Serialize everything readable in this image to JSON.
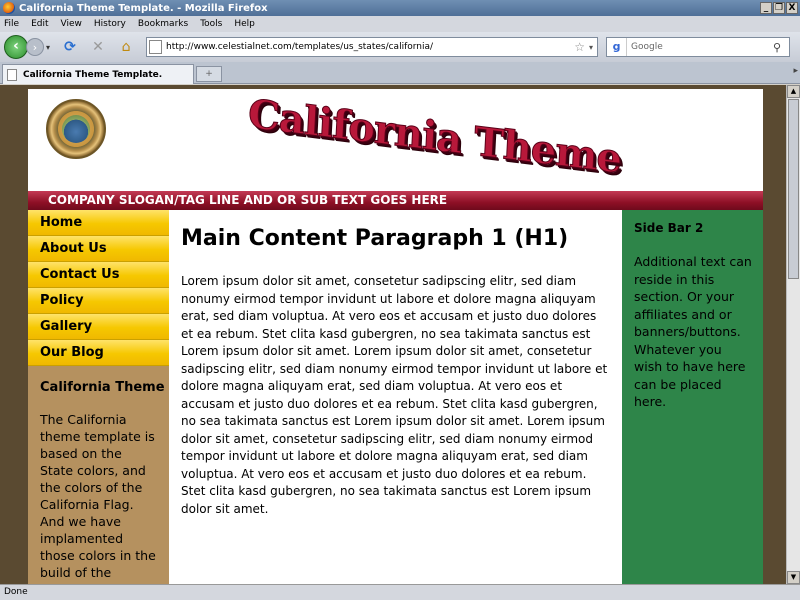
{
  "window": {
    "title": "California Theme Template. - Mozilla Firefox",
    "minimize": "_",
    "restore": "❐",
    "close": "X"
  },
  "menu": {
    "items": [
      "File",
      "Edit",
      "View",
      "History",
      "Bookmarks",
      "Tools",
      "Help"
    ]
  },
  "nav": {
    "url": "http://www.celestialnet.com/templates/us_states/california/",
    "search_placeholder": "Google",
    "back_glyph": "‹",
    "forward_glyph": "›",
    "reload_glyph": "⟳",
    "stop_glyph": "✕",
    "home_glyph": "⌂",
    "star_glyph": "☆",
    "dropdown_glyph": "▾",
    "search_engine_glyph": "g",
    "search_glyph": "⚲"
  },
  "tabs": [
    {
      "label": "California Theme Template."
    }
  ],
  "tabbar": {
    "newtab_glyph": "+",
    "scroll_glyph": "▸"
  },
  "site": {
    "logo_text": "California Theme",
    "slogan": "COMPANY SLOGAN/TAG LINE AND OR SUB TEXT GOES HERE",
    "menu": [
      "Home",
      "About Us",
      "Contact Us",
      "Policy",
      "Gallery",
      "Our Blog"
    ],
    "sidebar1": {
      "title": "California Theme",
      "text": "The California theme template is based on the State colors, and the colors of the California Flag. And we have implamented those colors in the build of the"
    },
    "main": {
      "heading": "Main Content Paragraph 1 (H1)",
      "paragraph": "Lorem ipsum dolor sit amet, consetetur sadipscing elitr, sed diam nonumy eirmod tempor invidunt ut labore et dolore magna aliquyam erat, sed diam voluptua. At vero eos et accusam et justo duo dolores et ea rebum. Stet clita kasd gubergren, no sea takimata sanctus est Lorem ipsum dolor sit amet. Lorem ipsum dolor sit amet, consetetur sadipscing elitr, sed diam nonumy eirmod tempor invidunt ut labore et dolore magna aliquyam erat, sed diam voluptua. At vero eos et accusam et justo duo dolores et ea rebum. Stet clita kasd gubergren, no sea takimata sanctus est Lorem ipsum dolor sit amet. Lorem ipsum dolor sit amet, consetetur sadipscing elitr, sed diam nonumy eirmod tempor invidunt ut labore et dolore magna aliquyam erat, sed diam voluptua. At vero eos et accusam et justo duo dolores et ea rebum. Stet clita kasd gubergren, no sea takimata sanctus est Lorem ipsum dolor sit amet."
    },
    "sidebar2": {
      "title": "Side Bar 2",
      "text": "Additional text can reside in this section. Or your affiliates and or banners/buttons. Whatever you wish to have here can be placed here."
    }
  },
  "scrollbar": {
    "up_glyph": "▲",
    "down_glyph": "▼"
  },
  "status": {
    "text": "Done"
  },
  "colors": {
    "menu_gold": "#f6c800",
    "slogan_red": "#8e1026",
    "left_tan": "#b5915f",
    "right_green": "#2e8549",
    "page_brown": "#5a4a31"
  }
}
